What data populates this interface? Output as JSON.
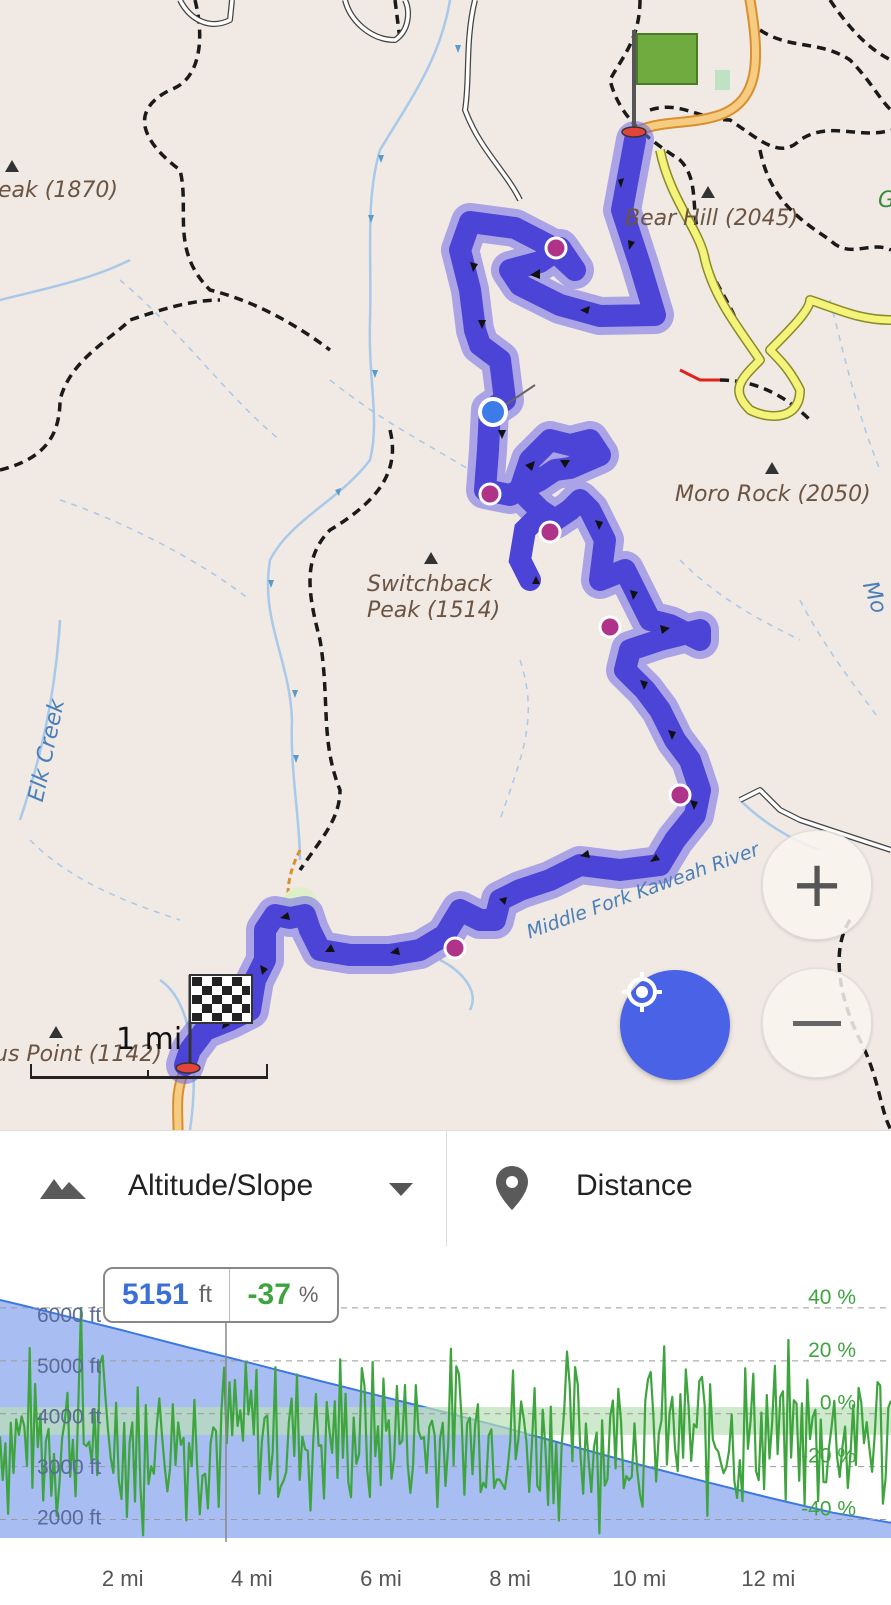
{
  "map": {
    "labels": {
      "peak_left": "eak (1870)",
      "bear_hill": "Bear Hill (2045)",
      "moro_rock": "Moro Rock (2050)",
      "switchback_line1": "Switchback",
      "switchback_line2": "Peak (1514)",
      "elk_creek": "Elk Creek",
      "river": "Middle Fork Kaweah River",
      "point_left": "us Point (1142)",
      "edge_right": "Mo",
      "edge_g": "G"
    },
    "scale_label": "1 mi",
    "zoom_in_icon": "plus-icon",
    "zoom_out_icon": "minus-icon",
    "locate_icon": "crosshair-icon",
    "route_color": "#4b44d6",
    "waypoint_color": "#b0338a",
    "position_color": "#3d7be8"
  },
  "toolbar": {
    "left_icon": "mountains-icon",
    "left_label": "Altitude/Slope",
    "dropdown_icon": "caret-down-icon",
    "right_icon": "map-pin-icon",
    "right_label": "Distance"
  },
  "readout": {
    "altitude_value": "5151",
    "altitude_unit": "ft",
    "slope_value": "-37",
    "slope_unit": "%"
  },
  "chart_data": {
    "type": "area",
    "x_unit": "mi",
    "xticks": [
      "2 mi",
      "4 mi",
      "6 mi",
      "8 mi",
      "10 mi",
      "12 mi"
    ],
    "xlim": [
      0.1,
      13.9
    ],
    "left_yticks": [
      "6000 ft",
      "5000 ft",
      "4000 ft",
      "3000 ft",
      "2000 ft"
    ],
    "left_ylim": [
      1600,
      6300
    ],
    "right_yticks": [
      "40 %",
      "20 %",
      "0 %",
      "-20 %",
      "-40 %"
    ],
    "right_ylim": [
      -47,
      43
    ],
    "cursor_x": 3.6,
    "series": [
      {
        "color": "#3b78e0",
        "points": [
          [
            0.1,
            6300
          ],
          [
            0.5,
            6180
          ],
          [
            1,
            6020
          ],
          [
            2,
            5700
          ],
          [
            3,
            5370
          ],
          [
            4,
            5050
          ],
          [
            5,
            4720
          ],
          [
            6,
            4400
          ],
          [
            7,
            4080
          ],
          [
            8,
            3750
          ],
          [
            9,
            3400
          ],
          [
            10,
            3050
          ],
          [
            11,
            2720
          ],
          [
            12,
            2400
          ],
          [
            13,
            2100
          ],
          [
            13.9,
            1900
          ]
        ]
      },
      {
        "color": "#3ea53e",
        "amplitude": 38
      }
    ]
  }
}
